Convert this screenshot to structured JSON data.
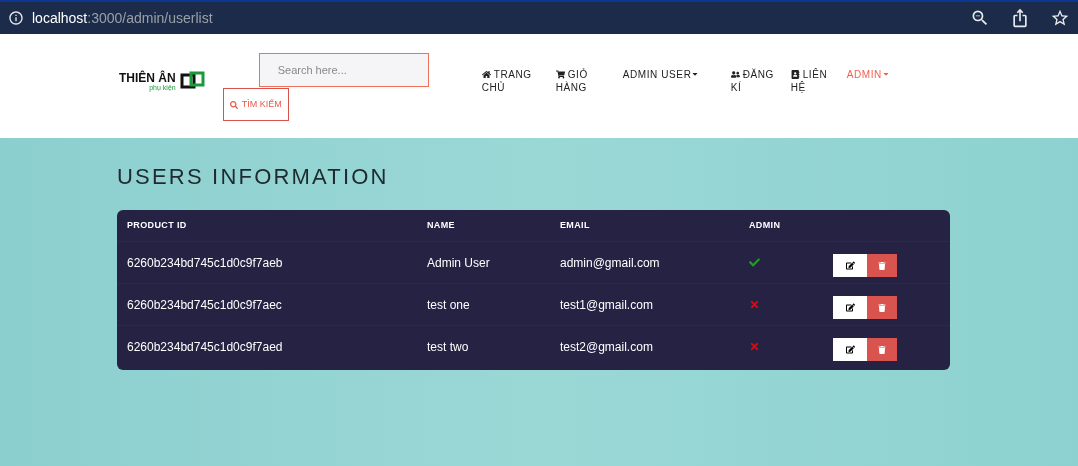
{
  "browser": {
    "url_host": "localhost",
    "url_path": ":3000/admin/userlist"
  },
  "header": {
    "logo": {
      "name": "THIÊN ÂN",
      "tagline": "phụ kiện"
    },
    "search": {
      "placeholder": "Search here...",
      "button": "TÌM KIẾM"
    },
    "nav": [
      {
        "label": "TRANG CHỦ",
        "kind": "link",
        "selected": false
      },
      {
        "label": "GIỎ HÀNG",
        "kind": "link",
        "selected": false
      },
      {
        "label": "ADMIN USER",
        "kind": "dropdown",
        "selected": false
      },
      {
        "label": "ĐĂNG KÍ",
        "kind": "link",
        "selected": false
      },
      {
        "label": "LIÊN HỆ",
        "kind": "link",
        "selected": false
      },
      {
        "label": "ADMIN",
        "kind": "dropdown",
        "selected": true
      }
    ]
  },
  "page": {
    "title": "USERS INFORMATION",
    "table": {
      "columns": [
        "PRODUCT ID",
        "NAME",
        "EMAIL",
        "ADMIN"
      ],
      "rows": [
        {
          "id": "6260b234bd745c1d0c9f7aeb",
          "name": "Admin User",
          "email": "admin@gmail.com",
          "admin": true
        },
        {
          "id": "6260b234bd745c1d0c9f7aec",
          "name": "test one",
          "email": "test1@gmail.com",
          "admin": false
        },
        {
          "id": "6260b234bd745c1d0c9f7aed",
          "name": "test two",
          "email": "test2@gmail.com",
          "admin": false
        }
      ]
    }
  }
}
